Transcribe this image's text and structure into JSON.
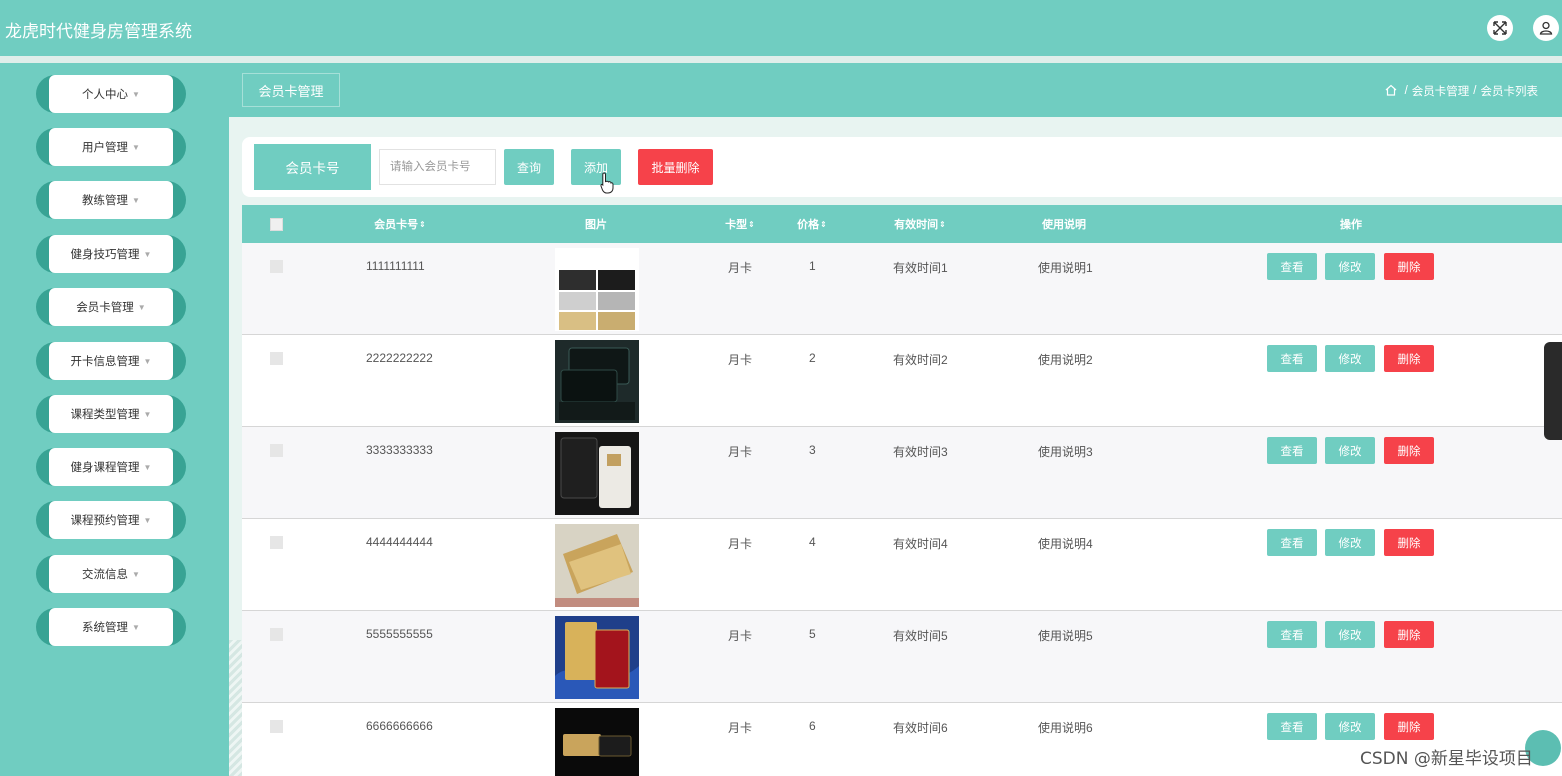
{
  "app": {
    "title": "龙虎时代健身房管理系统"
  },
  "header": {
    "fullscreen_icon": "fullscreen-icon",
    "user_icon": "user-icon"
  },
  "sidebar": {
    "items": [
      {
        "label": "个人中心"
      },
      {
        "label": "用户管理"
      },
      {
        "label": "教练管理"
      },
      {
        "label": "健身技巧管理"
      },
      {
        "label": "会员卡管理"
      },
      {
        "label": "开卡信息管理"
      },
      {
        "label": "课程类型管理"
      },
      {
        "label": "健身课程管理"
      },
      {
        "label": "课程预约管理"
      },
      {
        "label": "交流信息"
      },
      {
        "label": "系统管理"
      }
    ]
  },
  "breadcrumb": {
    "tab": "会员卡管理",
    "items": [
      "会员卡管理",
      "会员卡列表"
    ],
    "separator": "/"
  },
  "search": {
    "label": "会员卡号",
    "placeholder": "请输入会员卡号",
    "value": "",
    "query_button": "查询",
    "add_button": "添加",
    "batch_delete_button": "批量删除"
  },
  "table": {
    "columns": {
      "card_no": "会员卡号",
      "image": "图片",
      "card_type": "卡型",
      "price": "价格",
      "valid_time": "有效时间",
      "usage": "使用说明",
      "actions": "操作"
    },
    "actions": {
      "view": "查看",
      "edit": "修改",
      "delete": "删除"
    },
    "rows": [
      {
        "card_no": "1111111111",
        "card_type": "月卡",
        "price": "1",
        "valid_time": "有效时间1",
        "usage": "使用说明1"
      },
      {
        "card_no": "2222222222",
        "card_type": "月卡",
        "price": "2",
        "valid_time": "有效时间2",
        "usage": "使用说明2"
      },
      {
        "card_no": "3333333333",
        "card_type": "月卡",
        "price": "3",
        "valid_time": "有效时间3",
        "usage": "使用说明3"
      },
      {
        "card_no": "4444444444",
        "card_type": "月卡",
        "price": "4",
        "valid_time": "有效时间4",
        "usage": "使用说明4"
      },
      {
        "card_no": "5555555555",
        "card_type": "月卡",
        "price": "5",
        "valid_time": "有效时间5",
        "usage": "使用说明5"
      },
      {
        "card_no": "6666666666",
        "card_type": "月卡",
        "price": "6",
        "valid_time": "有效时间6",
        "usage": "使用说明6"
      }
    ]
  },
  "watermark": "CSDN @新星毕设项目",
  "colors": {
    "primary": "#70cdc1",
    "danger": "#f6424a",
    "sidebar_pill": "#38a394"
  }
}
